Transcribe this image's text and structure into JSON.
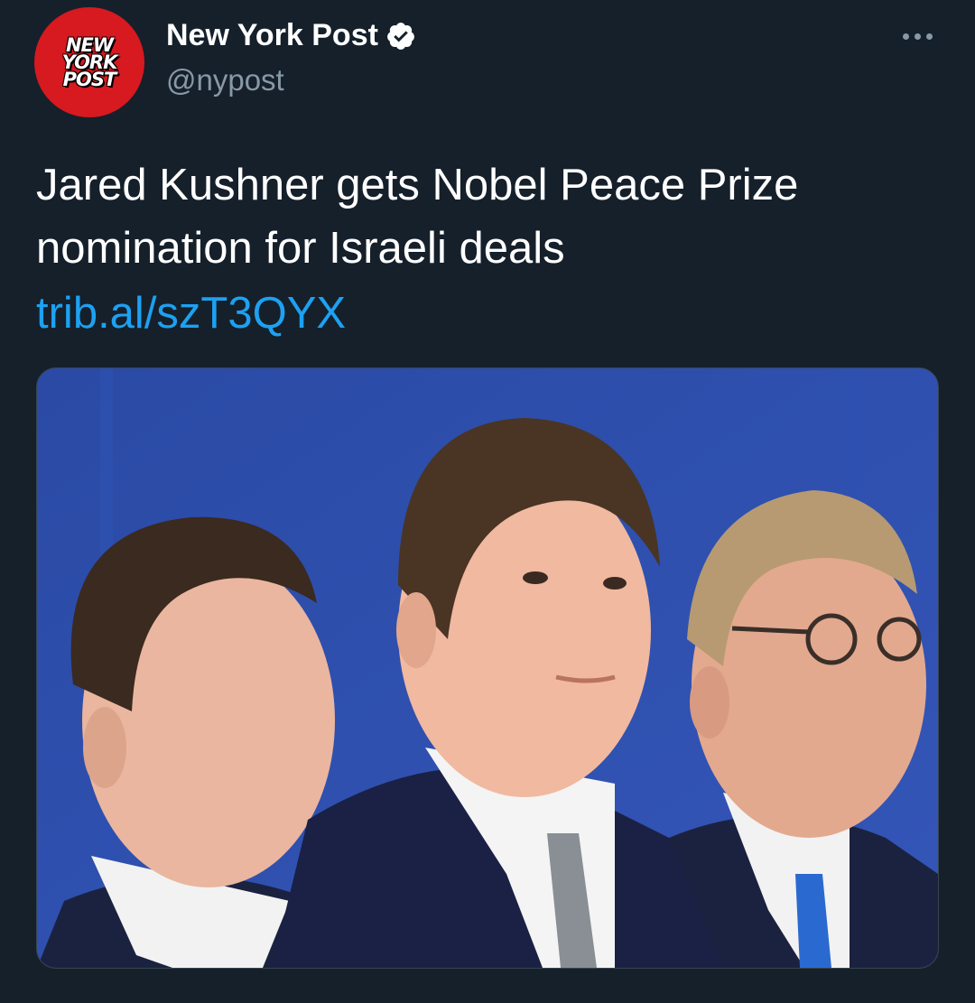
{
  "account": {
    "avatar_logo_lines": [
      "NEW",
      "YORK",
      "POST"
    ],
    "display_name": "New York Post",
    "handle": "@nypost",
    "verified": true
  },
  "tweet": {
    "text": "Jared Kushner gets Nobel Peace Prize nomination for Israeli deals",
    "link": "trib.al/szT3QYX"
  },
  "icons": {
    "more": "more-horizontal-icon",
    "verified": "verified-badge-icon"
  },
  "colors": {
    "background": "#15202b",
    "link": "#1da1f2",
    "secondary_text": "#8899a6",
    "avatar_red": "#d71920",
    "photo_backdrop": "#2c4fa8"
  }
}
